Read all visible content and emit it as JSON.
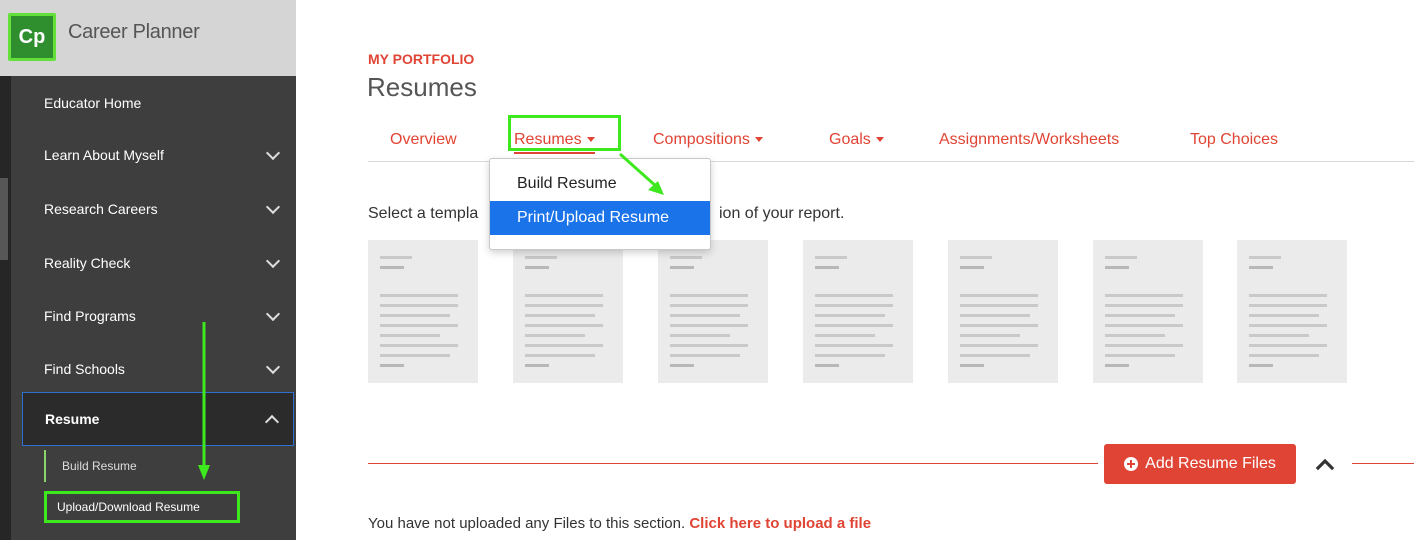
{
  "brand": {
    "logo_text": "Cp",
    "name": "Career Planner"
  },
  "sidebar": {
    "items": [
      {
        "label": "Educator Home",
        "chevron": false
      },
      {
        "label": "Learn About Myself",
        "chevron": "down"
      },
      {
        "label": "Research Careers",
        "chevron": "down"
      },
      {
        "label": "Reality Check",
        "chevron": "down"
      },
      {
        "label": "Find Programs",
        "chevron": "down"
      },
      {
        "label": "Find Schools",
        "chevron": "down"
      },
      {
        "label": "Resume",
        "chevron": "up",
        "active": true
      }
    ],
    "subitems": [
      {
        "label": "Build Resume"
      },
      {
        "label": "Upload/Download Resume",
        "highlighted": true
      }
    ]
  },
  "header": {
    "kicker": "MY PORTFOLIO",
    "title": "Resumes"
  },
  "tabs": [
    {
      "label": "Overview"
    },
    {
      "label": "Resumes",
      "dropdown": true,
      "active": true
    },
    {
      "label": "Compositions",
      "dropdown": true
    },
    {
      "label": "Goals",
      "dropdown": true
    },
    {
      "label": "Assignments/Worksheets"
    },
    {
      "label": "Top Choices"
    }
  ],
  "dropdown": {
    "items": [
      {
        "label": "Build Resume"
      },
      {
        "label": "Print/Upload Resume",
        "selected": true
      }
    ]
  },
  "templates": {
    "prompt_left": "Select a templa",
    "prompt_right": "ion of your report.",
    "count": 7
  },
  "files": {
    "add_button": "Add Resume Files",
    "empty_message": "You have not uploaded any Files to this section.",
    "upload_link": "Click here to upload a file"
  },
  "colors": {
    "accent": "#e04434",
    "sidebar": "#3e3e3e",
    "selected": "#1a73e8",
    "annotation": "#3ee81f"
  },
  "icons": {
    "plus": "plus-circle-icon",
    "collapse": "chevron-up-icon",
    "nav_chevron": "chevron-down-icon"
  }
}
